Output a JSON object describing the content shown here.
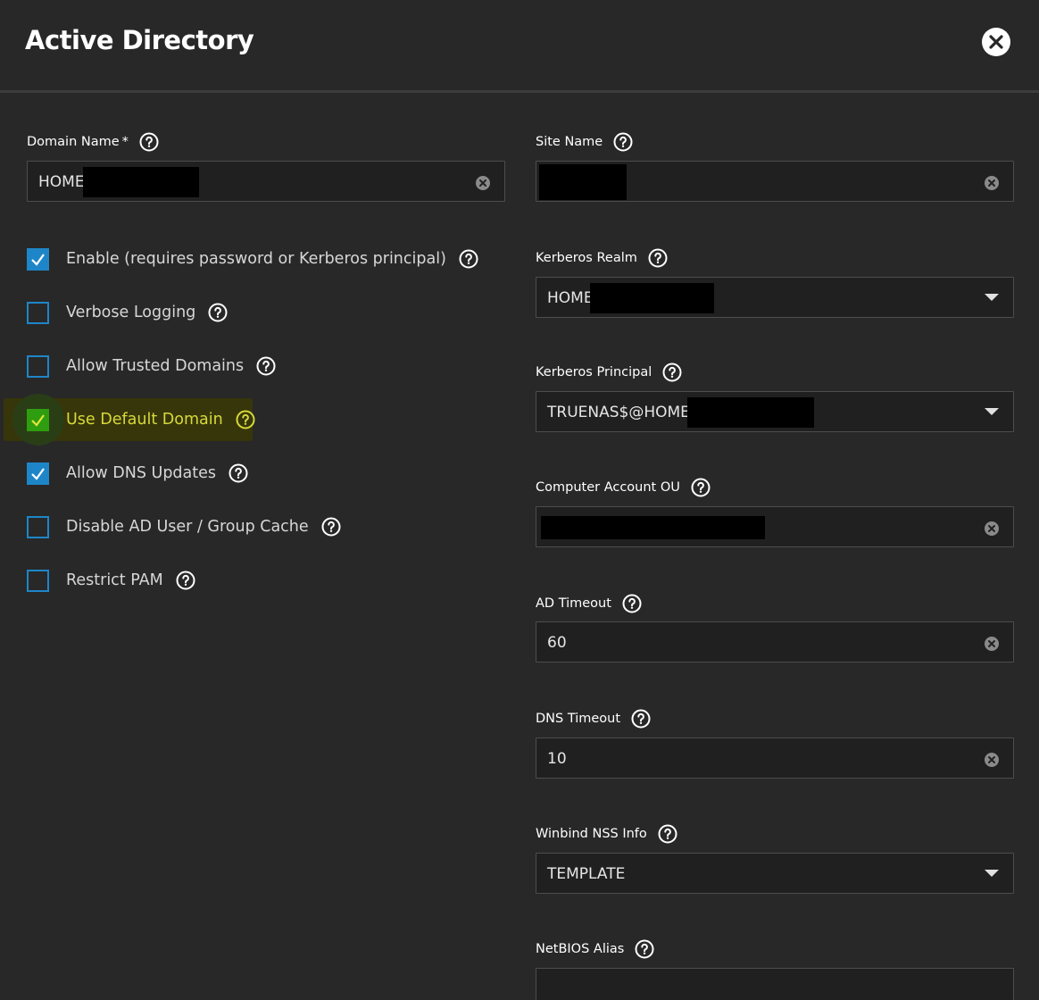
{
  "dialog": {
    "title": "Active Directory"
  },
  "left": {
    "domain_name": {
      "label": "Domain Name",
      "required_mark": "*",
      "value": "HOME"
    },
    "checkboxes": [
      {
        "label": "Enable (requires password or Kerberos principal)",
        "checked": true
      },
      {
        "label": "Verbose Logging",
        "checked": false
      },
      {
        "label": "Allow Trusted Domains",
        "checked": false
      },
      {
        "label": "Use Default Domain",
        "checked": true,
        "highlighted": true
      },
      {
        "label": "Allow DNS Updates",
        "checked": true
      },
      {
        "label": "Disable AD User / Group Cache",
        "checked": false
      },
      {
        "label": "Restrict PAM",
        "checked": false
      }
    ]
  },
  "right": {
    "site_name": {
      "label": "Site Name",
      "value": ""
    },
    "kerberos_realm": {
      "label": "Kerberos Realm",
      "value": "HOME"
    },
    "kerberos_principal": {
      "label": "Kerberos Principal",
      "value": "TRUENAS$@HOME"
    },
    "computer_account_ou": {
      "label": "Computer Account OU",
      "value": ""
    },
    "ad_timeout": {
      "label": "AD Timeout",
      "value": "60"
    },
    "dns_timeout": {
      "label": "DNS Timeout",
      "value": "10"
    },
    "winbind_nss_info": {
      "label": "Winbind NSS Info",
      "value": "TEMPLATE"
    },
    "netbios_alias": {
      "label": "NetBIOS Alias",
      "value": ""
    }
  },
  "colors": {
    "background": "#282828",
    "checkbox_accent": "#1e86c8",
    "highlight_label": "#d7d93a",
    "highlight_check": "#2f9d10"
  },
  "icons": {
    "close": "close-icon",
    "help": "help-icon",
    "clear": "clear-icon",
    "dropdown": "chevron-down-icon"
  }
}
